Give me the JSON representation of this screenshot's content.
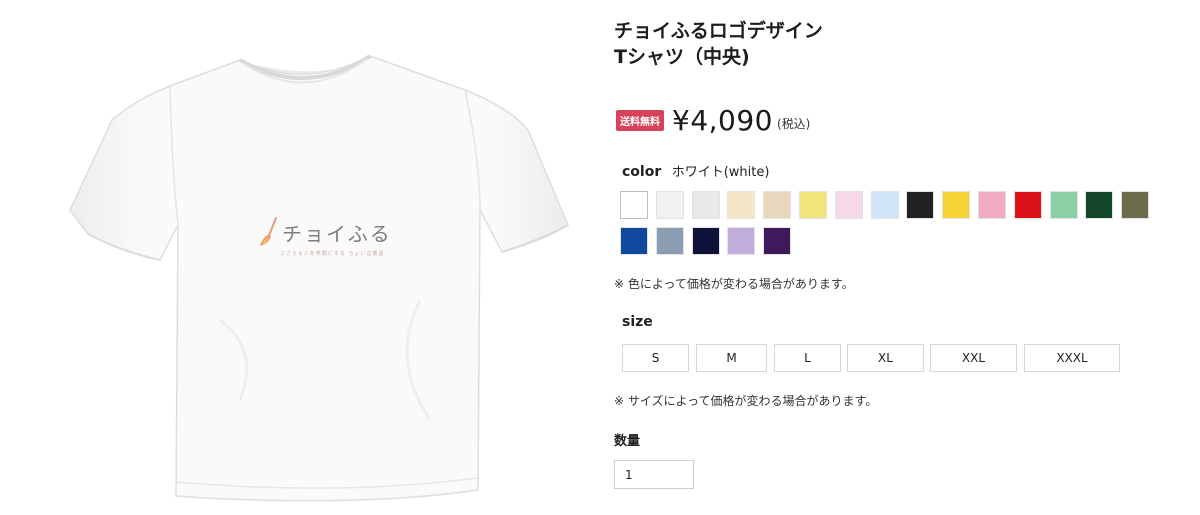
{
  "product": {
    "title_line1": "チョイふるロゴデザイン",
    "title_line2": "Tシャツ（中央)",
    "badge": "送料無料",
    "price": "¥4,090",
    "tax_note": "(税込)"
  },
  "shirt_print": {
    "logo_text": "チョイふる",
    "tagline": "ささえる人を笑顔にする ちょい古着屋"
  },
  "color": {
    "label": "color",
    "selected_value": "ホワイト(white)",
    "swatches": [
      {
        "name": "white",
        "hex": "#ffffff"
      },
      {
        "name": "ash",
        "hex": "#f1f1ef"
      },
      {
        "name": "light-gray",
        "hex": "#e8e8e8"
      },
      {
        "name": "natural",
        "hex": "#f5e6c8"
      },
      {
        "name": "beige",
        "hex": "#e8d8bd"
      },
      {
        "name": "light-yellow",
        "hex": "#efe57c"
      },
      {
        "name": "light-pink",
        "hex": "#f6d8e6"
      },
      {
        "name": "light-blue",
        "hex": "#cfe4f6"
      },
      {
        "name": "black",
        "hex": "#222222"
      },
      {
        "name": "yellow",
        "hex": "#f7d437"
      },
      {
        "name": "pink",
        "hex": "#f0aac2"
      },
      {
        "name": "red",
        "hex": "#dd1219"
      },
      {
        "name": "mint",
        "hex": "#8bd0a4"
      },
      {
        "name": "forest",
        "hex": "#12452a"
      },
      {
        "name": "olive",
        "hex": "#6d6b4b"
      },
      {
        "name": "royal-blue",
        "hex": "#104a9e"
      },
      {
        "name": "blue-gray",
        "hex": "#8a9db1"
      },
      {
        "name": "navy",
        "hex": "#0f1238"
      },
      {
        "name": "lavender",
        "hex": "#c0addb"
      },
      {
        "name": "purple",
        "hex": "#3e1a5c"
      }
    ],
    "note": "※ 色によって価格が変わる場合があります。"
  },
  "size": {
    "label": "size",
    "options": [
      "S",
      "M",
      "L",
      "XL",
      "XXL",
      "XXXL"
    ],
    "note": "※ サイズによって価格が変わる場合があります。"
  },
  "quantity": {
    "label": "数量",
    "value": "1"
  }
}
